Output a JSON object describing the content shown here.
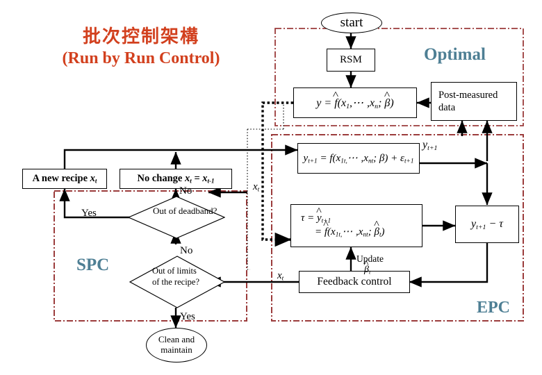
{
  "title": {
    "chinese": "批次控制架構",
    "english": "(Run by Run Control)",
    "color": "#d2401e"
  },
  "regions": {
    "optimal": {
      "label": "Optimal",
      "color": "#4e7f94",
      "border_color": "#9b3b3b",
      "border_style": "dash-dot"
    },
    "epc": {
      "label": "EPC",
      "color": "#4e7f94",
      "border_color": "#9b3b3b",
      "border_style": "dash-dot"
    },
    "spc": {
      "label": "SPC",
      "color": "#4e7f94",
      "border_color": "#9b3b3b",
      "border_style": "dash-dot"
    }
  },
  "nodes": {
    "start": "start",
    "rsm": "RSM",
    "model_static": "y = f̂(x₁, … , xₙ; β̂)",
    "post_measured": "Post-measured data",
    "response": "yₜ₊₁ = f(x₁ₜ, … , xₙₜ; β) + εₜ₊₁",
    "tau_line1": "τ = ŷₜ₊₁",
    "tau_line2": "= f̂(x₁ₜ, … , xₙₜ; β̂ₜ)",
    "error": "yₜ₊₁ − τ",
    "feedback": "Feedback control",
    "new_recipe": "A new recipe xₜ",
    "no_change": "No change xₜ = xₜ₋₁",
    "decision_deadband": "Out of deadband?",
    "decision_limits": "Out of limits of the recipe?",
    "clean": "Clean and maintain"
  },
  "edge_labels": {
    "yes_deadband": "Yes",
    "no_deadband": "No",
    "no_limits": "No",
    "yes_limits": "Yes",
    "x_t_upper": "xₜ",
    "x_t_lower": "xₜ",
    "y_t1": "yₜ₊₁",
    "update": "Update",
    "update_beta": "β̂ₜ"
  },
  "styling": {
    "line_color": "#000000",
    "dotted_thick": "#000000",
    "dotted_thin": "#000000"
  }
}
